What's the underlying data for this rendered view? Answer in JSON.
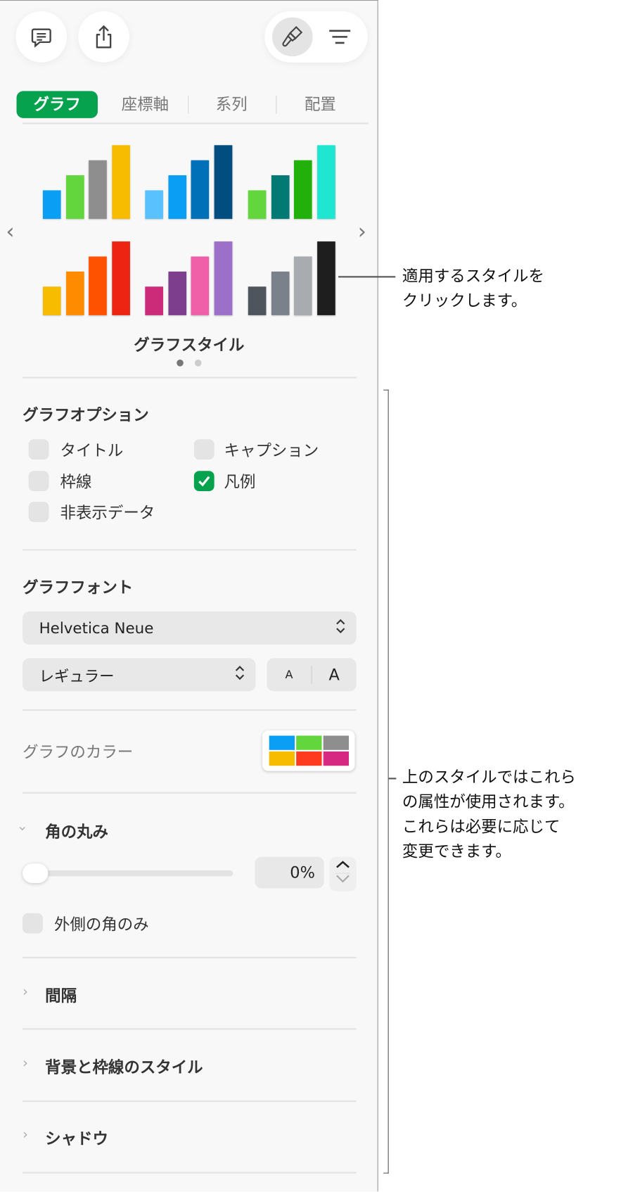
{
  "toolbar": {
    "comment": "comment-icon",
    "share": "share-icon",
    "format": "paintbrush-icon",
    "organize": "list-icon"
  },
  "tabs": [
    {
      "label": "グラフ",
      "active": true
    },
    {
      "label": "座標軸"
    },
    {
      "label": "系列"
    },
    {
      "label": "配置"
    }
  ],
  "chart_styles": {
    "label": "グラフスタイル",
    "page": 1,
    "pages": 2,
    "styles": [
      [
        "#0a9ff5",
        "#62d63c",
        "#8e8e8e",
        "#f7bb00"
      ],
      [
        "#5ac1ff",
        "#0a9ff5",
        "#0070b8",
        "#004d80"
      ],
      [
        "#62d63c",
        "#007a72",
        "#22b00a",
        "#1ee6d0"
      ],
      [
        "#f7bb00",
        "#ff8c00",
        "#ff5200",
        "#ee2412"
      ],
      [
        "#cc2b7a",
        "#7e3e8e",
        "#f060a8",
        "#9c6fc8"
      ],
      [
        "#4f555c",
        "#7a818a",
        "#a8abb0",
        "#1e1e1e"
      ]
    ]
  },
  "options": {
    "heading": "グラフオプション",
    "items": [
      {
        "label": "タイトル",
        "checked": false
      },
      {
        "label": "キャプション",
        "checked": false
      },
      {
        "label": "枠線",
        "checked": false
      },
      {
        "label": "凡例",
        "checked": true
      },
      {
        "label": "非表示データ",
        "checked": false
      }
    ]
  },
  "font": {
    "heading": "グラフフォント",
    "family": "Helvetica Neue",
    "style": "レギュラー",
    "smaller": "A",
    "larger": "A"
  },
  "colors": {
    "label": "グラフのカラー",
    "swatches": [
      "#0a9ff5",
      "#62d63c",
      "#8e8e8e",
      "#f7bb00",
      "#ff3b1f",
      "#d62a82"
    ]
  },
  "corner": {
    "heading": "角の丸み",
    "value": "0%",
    "outer_only": "外側の角のみ",
    "slider_fraction": 0
  },
  "sections": [
    "間隔",
    "背景と枠線のスタイル",
    "シャドウ"
  ],
  "annotations": {
    "top": [
      "適用するスタイルを",
      "クリックします。"
    ],
    "bottom": [
      "上のスタイルではこれら",
      "の属性が使用されます。",
      "これらは必要に応じて",
      "変更できます。"
    ]
  }
}
